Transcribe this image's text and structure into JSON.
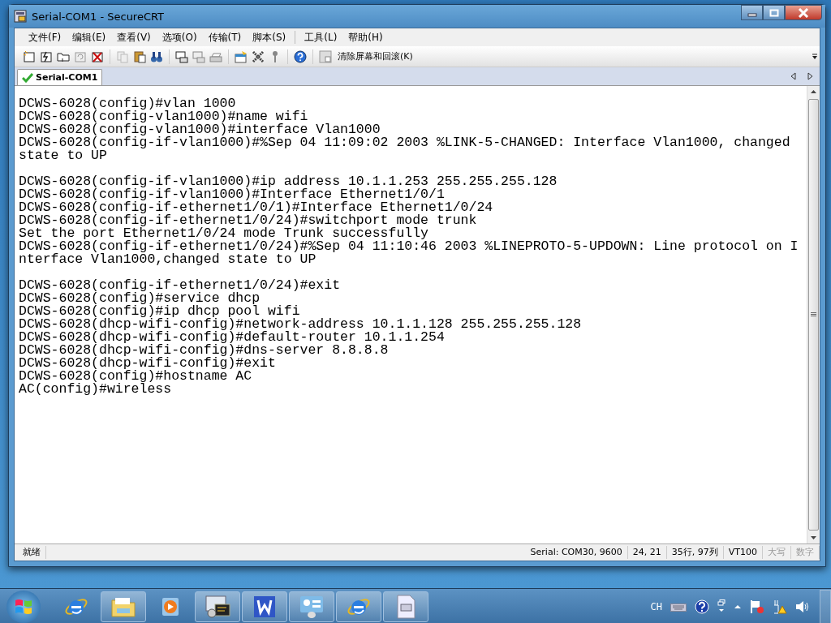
{
  "window": {
    "title": "Serial-COM1 - SecureCRT"
  },
  "menu": [
    "文件(F)",
    "编辑(E)",
    "查看(V)",
    "选项(O)",
    "传输(T)",
    "脚本(S)",
    "工具(L)",
    "帮助(H)"
  ],
  "toolbar": {
    "clear_button": "清除屏幕和回滚(K)"
  },
  "tabs": [
    {
      "label": "Serial-COM1",
      "selected": true,
      "connected": true
    }
  ],
  "terminal": {
    "blocks": [
      [
        "DCWS-6028(config)#vlan 1000",
        "DCWS-6028(config-vlan1000)#name wifi",
        "DCWS-6028(config-vlan1000)#interface Vlan1000",
        "DCWS-6028(config-if-vlan1000)#%Sep 04 11:09:02 2003 %LINK-5-CHANGED: Interface Vlan1000, changed",
        "state to UP"
      ],
      [
        "DCWS-6028(config-if-vlan1000)#ip address 10.1.1.253 255.255.255.128",
        "DCWS-6028(config-if-vlan1000)#Interface Ethernet1/0/1",
        "DCWS-6028(config-if-ethernet1/0/1)#Interface Ethernet1/0/24",
        "DCWS-6028(config-if-ethernet1/0/24)#switchport mode trunk",
        "Set the port Ethernet1/0/24 mode Trunk successfully",
        "DCWS-6028(config-if-ethernet1/0/24)#%Sep 04 11:10:46 2003 %LINEPROTO-5-UPDOWN: Line protocol on I",
        "nterface Vlan1000,changed state to UP"
      ],
      [
        "DCWS-6028(config-if-ethernet1/0/24)#exit",
        "DCWS-6028(config)#service dhcp",
        "DCWS-6028(config)#ip dhcp pool wifi",
        "DCWS-6028(dhcp-wifi-config)#network-address 10.1.1.128 255.255.255.128",
        "DCWS-6028(dhcp-wifi-config)#default-router 10.1.1.254",
        "DCWS-6028(dhcp-wifi-config)#dns-server 8.8.8.8",
        "DCWS-6028(dhcp-wifi-config)#exit",
        "DCWS-6028(config)#hostname AC",
        "AC(config)#wireless"
      ]
    ]
  },
  "status_bar": [
    {
      "text": "就绪",
      "disabled": false
    },
    {
      "text": "Serial: COM30, 9600",
      "disabled": false
    },
    {
      "text": "24,  21",
      "disabled": false
    },
    {
      "text": "35行, 97列",
      "disabled": false
    },
    {
      "text": "VT100",
      "disabled": false
    },
    {
      "text": "大写",
      "disabled": true
    },
    {
      "text": "数字",
      "disabled": true
    }
  ],
  "taskbar": {
    "items": [
      {
        "kind": "browser",
        "running": false
      },
      {
        "kind": "folder",
        "running": true
      },
      {
        "kind": "media",
        "running": false
      },
      {
        "kind": "terminal",
        "running": true
      },
      {
        "kind": "writer",
        "running": true
      },
      {
        "kind": "panel",
        "running": true
      },
      {
        "kind": "browser",
        "running": true
      },
      {
        "kind": "document",
        "running": true
      }
    ],
    "tray": {
      "language": "CH"
    }
  }
}
